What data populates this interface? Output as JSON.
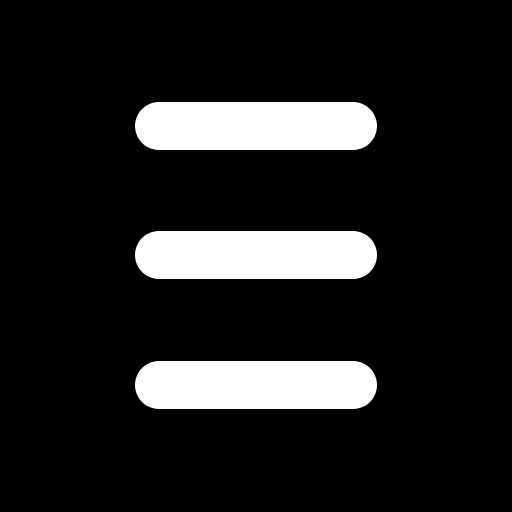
{
  "icon": {
    "name": "hamburger-menu-icon",
    "bar_count": 3
  },
  "colors": {
    "background": "#000000",
    "foreground": "#ffffff"
  }
}
